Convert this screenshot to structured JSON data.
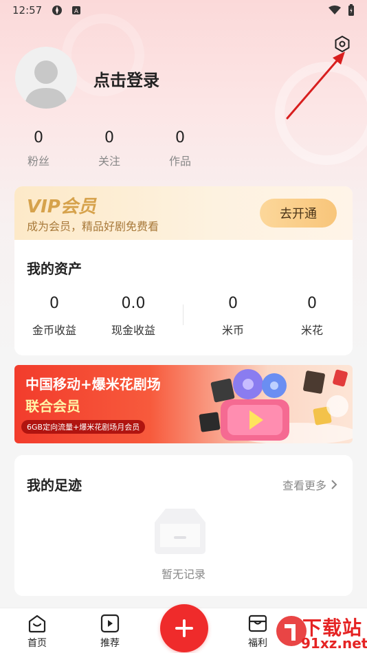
{
  "status_bar": {
    "time": "12:57"
  },
  "profile": {
    "login_text": "点击登录"
  },
  "stats": [
    {
      "value": "0",
      "label": "粉丝"
    },
    {
      "value": "0",
      "label": "关注"
    },
    {
      "value": "0",
      "label": "作品"
    }
  ],
  "vip": {
    "title": "VIP会员",
    "subtitle": "成为会员，精品好剧免费看",
    "button": "去开通"
  },
  "assets": {
    "title": "我的资产",
    "items": [
      {
        "value": "0",
        "label": "金币收益"
      },
      {
        "value": "0.0",
        "label": "现金收益"
      },
      {
        "value": "0",
        "label": "米币"
      },
      {
        "value": "0",
        "label": "米花"
      }
    ]
  },
  "banner": {
    "line1": "中国移动+爆米花剧场",
    "line2": "联合会员",
    "pill": "6GB定向流量+爆米花剧场月会员"
  },
  "footprint": {
    "title": "我的足迹",
    "more": "查看更多",
    "empty": "暂无记录"
  },
  "tabbar": {
    "home": "首页",
    "recommend": "推荐",
    "welfare": "福利"
  },
  "watermark": {
    "line1": "下载站",
    "line2": "91xz.net"
  },
  "colors": {
    "accent": "#ef2b2b",
    "vip_gold": "#d6a24c"
  }
}
